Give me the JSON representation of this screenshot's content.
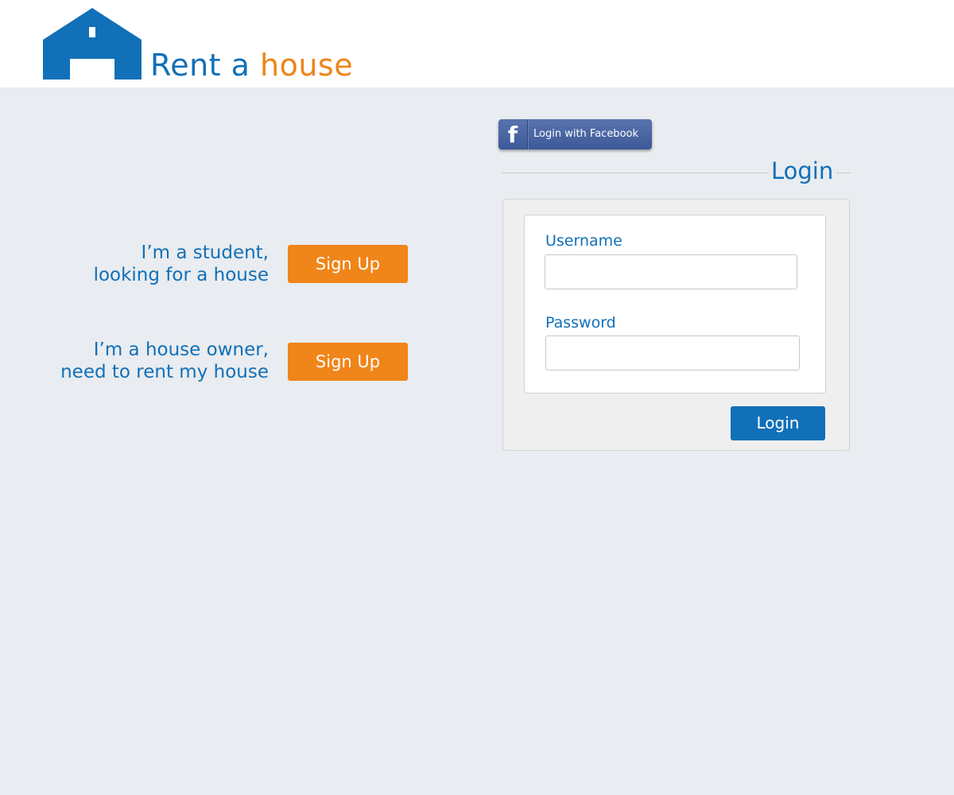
{
  "brand": {
    "name_part1": "Rent a ",
    "name_part2": "house",
    "primary_color": "#1170b8",
    "accent_color": "#ef8419",
    "logo_icon": "house-icon"
  },
  "signup": {
    "student": {
      "line1": "I’m a student,",
      "line2": "looking for a house",
      "button_label": "Sign Up"
    },
    "owner": {
      "line1": "I’m a house owner,",
      "line2": "need to rent my house",
      "button_label": "Sign Up"
    }
  },
  "facebook": {
    "icon": "facebook-f-icon",
    "icon_glyph": "f",
    "label": "Login with Facebook",
    "color": "#3c5a98"
  },
  "login": {
    "heading": "Login",
    "username_label": "Username",
    "username_value": "",
    "password_label": "Password",
    "password_value": "",
    "submit_label": "Login"
  }
}
